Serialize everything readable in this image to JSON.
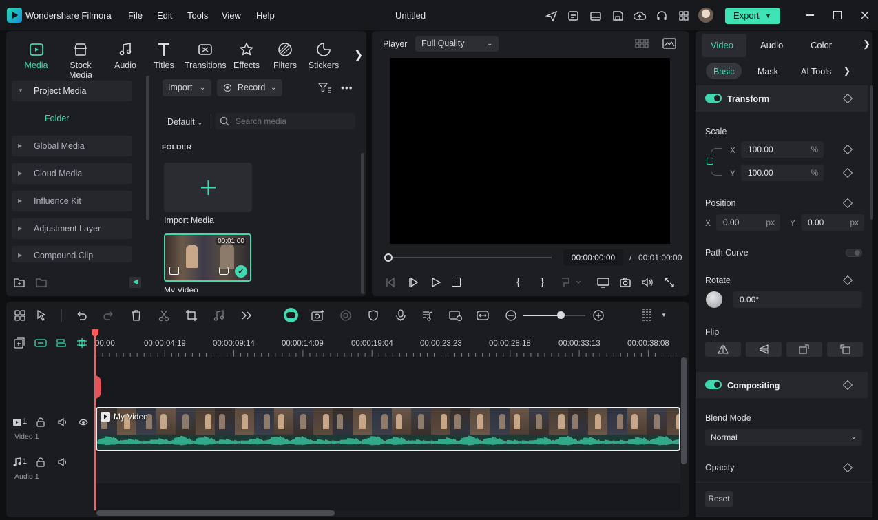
{
  "app": {
    "name": "Wondershare Filmora",
    "document_title": "Untitled",
    "export_label": "Export"
  },
  "menu": [
    "File",
    "Edit",
    "Tools",
    "View",
    "Help"
  ],
  "toolbar_tabs": [
    {
      "label": "Media",
      "icon": "media-icon",
      "active": true
    },
    {
      "label": "Stock Media",
      "icon": "stock-media-icon"
    },
    {
      "label": "Audio",
      "icon": "audio-icon"
    },
    {
      "label": "Titles",
      "icon": "titles-icon"
    },
    {
      "label": "Transitions",
      "icon": "transitions-icon"
    },
    {
      "label": "Effects",
      "icon": "effects-icon"
    },
    {
      "label": "Filters",
      "icon": "filters-icon"
    },
    {
      "label": "Stickers",
      "icon": "stickers-icon"
    }
  ],
  "sidebar": {
    "items": [
      "Project Media",
      "Folder",
      "Global Media",
      "Cloud Media",
      "Influence Kit",
      "Adjustment Layer",
      "Compound Clip"
    ]
  },
  "media": {
    "import_label": "Import",
    "record_label": "Record",
    "sort_label": "Default",
    "search_placeholder": "Search media",
    "folder_heading": "FOLDER",
    "import_media_label": "Import Media",
    "clip_duration": "00:01:00",
    "clip_name": "My Video"
  },
  "player": {
    "label": "Player",
    "quality": "Full Quality",
    "current_time": "00:00:00:00",
    "separator": "/",
    "total_time": "00:01:00:00"
  },
  "timeline": {
    "ruler": [
      "00:00",
      "00:00:04:19",
      "00:00:09:14",
      "00:00:14:09",
      "00:00:19:04",
      "00:00:23:23",
      "00:00:28:18",
      "00:00:33:13",
      "00:00:38:08"
    ],
    "video_track": {
      "number": "1",
      "name": "Video 1"
    },
    "audio_track": {
      "number": "1",
      "name": "Audio 1"
    },
    "clip_title": "My Video"
  },
  "properties": {
    "tabs": [
      "Video",
      "Audio",
      "Color"
    ],
    "subtabs": [
      "Basic",
      "Mask",
      "AI Tools"
    ],
    "transform_label": "Transform",
    "scale_label": "Scale",
    "scale_x_axis": "X",
    "scale_x": "100.00",
    "scale_y_axis": "Y",
    "scale_y": "100.00",
    "percent": "%",
    "position_label": "Position",
    "pos_x_axis": "X",
    "pos_x": "0.00",
    "pos_y_axis": "Y",
    "pos_y": "0.00",
    "px": "px",
    "path_curve_label": "Path Curve",
    "rotate_label": "Rotate",
    "rotate_value": "0.00°",
    "flip_label": "Flip",
    "compositing_label": "Compositing",
    "blend_mode_label": "Blend Mode",
    "blend_mode_value": "Normal",
    "opacity_label": "Opacity",
    "reset_label": "Reset"
  },
  "colors": {
    "accent": "#3fd8b0",
    "playhead": "#ff5a5a",
    "export_bg": "#3ee3b6"
  }
}
